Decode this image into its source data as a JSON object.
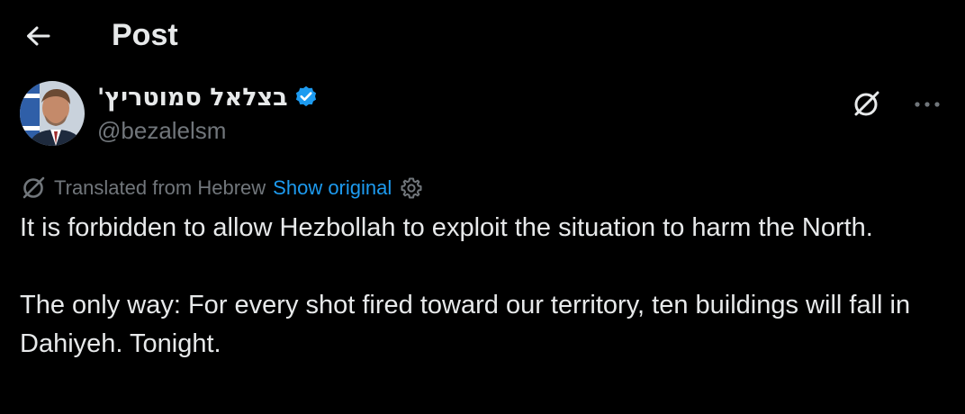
{
  "header": {
    "title": "Post",
    "back_icon": "arrow-left-icon"
  },
  "author": {
    "display_name": "בצלאל סמוטריץ'",
    "handle": "@bezalelsm",
    "verified": true,
    "verified_color": "#1d9bf0"
  },
  "actions": {
    "grok_icon": "grok-slash-icon",
    "more_icon": "more-dots-icon"
  },
  "translation": {
    "label": "Translated from Hebrew",
    "show_original": "Show original",
    "settings_icon": "gear-icon",
    "translate_icon": "translate-slash-icon"
  },
  "post": {
    "paragraphs": [
      "It is forbidden to allow Hezbollah to exploit the situation to harm the North.",
      "The only way: For every shot fired toward our territory, ten buildings will fall in Dahiyeh. Tonight."
    ]
  },
  "colors": {
    "background": "#000000",
    "primary_text": "#e7e9ea",
    "secondary_text": "#71767b",
    "accent": "#1d9bf0"
  }
}
